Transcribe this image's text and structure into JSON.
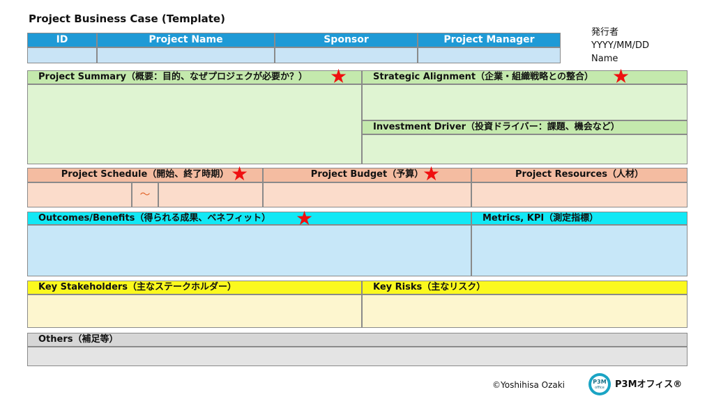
{
  "title": "Project Business Case (Template)",
  "issuer": {
    "label": "発行者",
    "date": "YYYY/MM/DD",
    "name": "Name"
  },
  "header_row": {
    "id": "ID",
    "project_name": "Project Name",
    "sponsor": "Sponsor",
    "project_manager": "Project Manager"
  },
  "sections": {
    "project_summary": "Project Summary（概要：目的、なぜプロジェクが必要か？）",
    "strategic_alignment": "Strategic Alignment（企業・組織戦略との整合）",
    "investment_driver": "Investment Driver（投資ドライバー：課題、機会など）",
    "project_schedule": "Project Schedule（開始、終了時期）",
    "schedule_separator": "～",
    "project_budget": "Project Budget（予算）",
    "project_resources": "Project Resources（人材）",
    "outcomes_benefits": "Outcomes/Benefits（得られる成果、ベネフィット）",
    "metrics_kpi": "Metrics, KPI（測定指標）",
    "key_stakeholders": "Key Stakeholders（主なステークホルダー）",
    "key_risks": "Key Risks（主なリスク）",
    "others": "Others（補足等）"
  },
  "star_glyph": "★",
  "star_color": "#ef1010",
  "footer": {
    "copyright": "©Yoshihisa Ozaki",
    "logo_badge": "P3M",
    "logo_badge_sub": "office",
    "brand": "P3Mオフィス®"
  }
}
